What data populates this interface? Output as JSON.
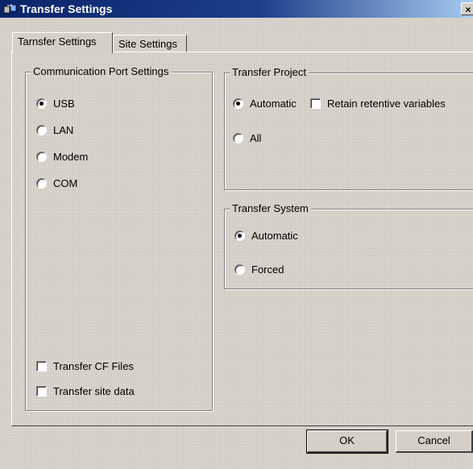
{
  "window": {
    "title": "Transfer Settings",
    "icon": "transfer-app-icon",
    "close_glyph": "×"
  },
  "tabs": [
    {
      "label": "Tarnsfer Settings",
      "selected": true
    },
    {
      "label": "Site Settings",
      "selected": false
    }
  ],
  "comm_port": {
    "legend": "Communication Port Settings",
    "options": [
      {
        "label": "USB",
        "checked": true
      },
      {
        "label": "LAN",
        "checked": false
      },
      {
        "label": "Modem",
        "checked": false
      },
      {
        "label": "COM",
        "checked": false
      }
    ],
    "transfer_cf_files": {
      "label": "Transfer CF Files",
      "checked": false
    },
    "transfer_site_data": {
      "label": "Transfer site data",
      "checked": false
    }
  },
  "transfer_project": {
    "legend": "Transfer Project",
    "automatic": {
      "label": "Automatic",
      "checked": true
    },
    "retain": {
      "label": "Retain retentive variables",
      "checked": false
    },
    "all": {
      "label": "All",
      "checked": false
    }
  },
  "transfer_system": {
    "legend": "Transfer System",
    "automatic": {
      "label": "Automatic",
      "checked": true
    },
    "forced": {
      "label": "Forced",
      "checked": false
    }
  },
  "buttons": {
    "ok": "OK",
    "cancel": "Cancel"
  }
}
